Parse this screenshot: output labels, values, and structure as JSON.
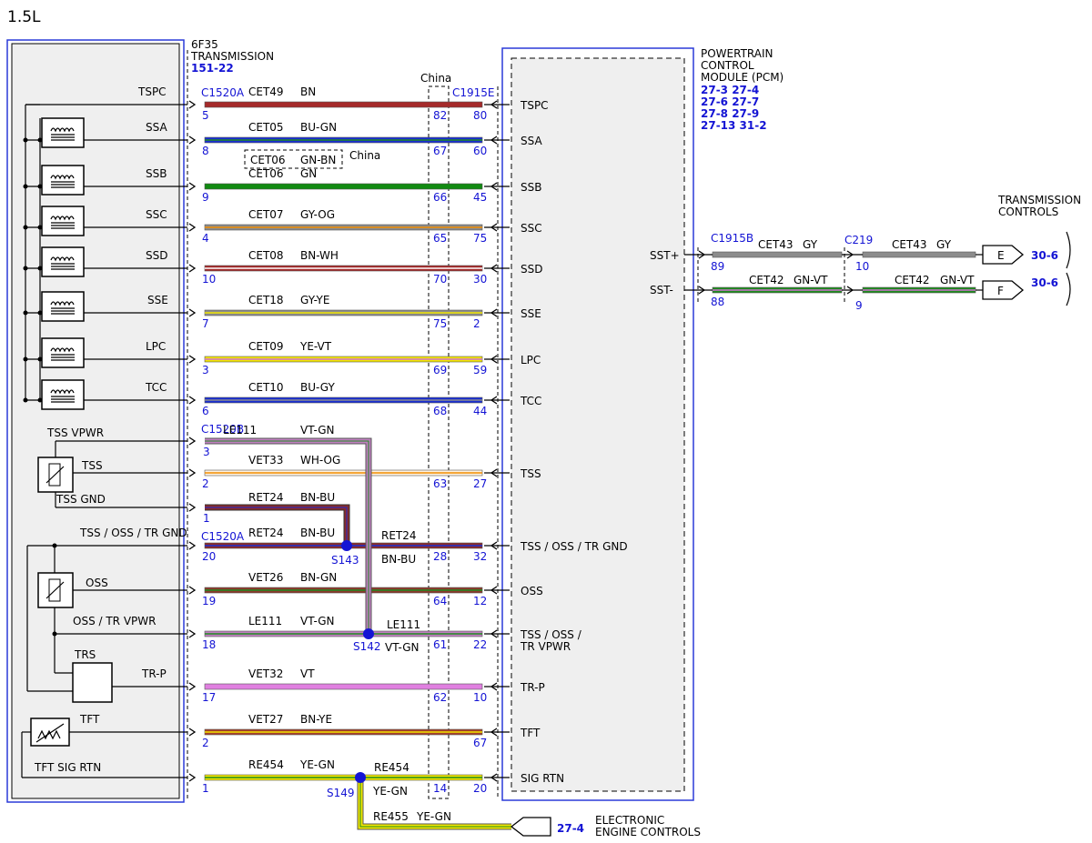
{
  "title": "1.5L",
  "trans": {
    "line1": "6F35",
    "line2": "TRANSMISSION",
    "ref": "151-22"
  },
  "pcm": {
    "line1": "POWERTRAIN",
    "line2": "CONTROL",
    "line3": "MODULE (PCM)",
    "refs": [
      "27-3  27-4",
      "27-6  27-7",
      "27-8  27-9",
      "27-13 31-2"
    ]
  },
  "china_label": "China",
  "china_alt": {
    "circuit": "CET06",
    "color": "GN-BN",
    "label": "China"
  },
  "conn": {
    "c1520a": "C1520A",
    "c1520b": "C1520B",
    "c1915e": "C1915E",
    "c1520a2": "C1520A",
    "c1915b": "C1915B",
    "c219": "C219"
  },
  "wires": [
    {
      "id": "tspc",
      "left": "TSPC",
      "circuit": "CET49",
      "color": "BN",
      "pin_l": "5",
      "pin_c": "82",
      "pin_r": "80",
      "right": "TSPC",
      "fill": "#a52a2a",
      "stripe": ""
    },
    {
      "id": "ssa",
      "left": "SSA",
      "circuit": "CET05",
      "color": "BU-GN",
      "pin_l": "8",
      "pin_c": "67",
      "pin_r": "60",
      "right": "SSA",
      "fill": "#1a2fd1",
      "stripe": "#1f8a1f"
    },
    {
      "id": "ssb",
      "left": "SSB",
      "circuit": "CET06",
      "color": "GN",
      "pin_l": "9",
      "pin_c": "66",
      "pin_r": "45",
      "right": "SSB",
      "fill": "#118a11",
      "stripe": ""
    },
    {
      "id": "ssc",
      "left": "SSC",
      "circuit": "CET07",
      "color": "GY-OG",
      "pin_l": "4",
      "pin_c": "65",
      "pin_r": "75",
      "right": "SSC",
      "fill": "#8c8c8c",
      "stripe": "#f08c00"
    },
    {
      "id": "ssd",
      "left": "SSD",
      "circuit": "CET08",
      "color": "BN-WH",
      "pin_l": "10",
      "pin_c": "70",
      "pin_r": "30",
      "right": "SSD",
      "fill": "#a52a2a",
      "stripe": "#ffffff"
    },
    {
      "id": "sse",
      "left": "SSE",
      "circuit": "CET18",
      "color": "GY-YE",
      "pin_l": "7",
      "pin_c": "75",
      "pin_r": "2",
      "right": "SSE",
      "fill": "#8c8c8c",
      "stripe": "#f2e600"
    },
    {
      "id": "lpc",
      "left": "LPC",
      "circuit": "CET09",
      "color": "YE-VT",
      "pin_l": "3",
      "pin_c": "69",
      "pin_r": "59",
      "right": "LPC",
      "fill": "#f2e600",
      "stripe": "#d070d0"
    },
    {
      "id": "tcc",
      "left": "TCC",
      "circuit": "CET10",
      "color": "BU-GY",
      "pin_l": "6",
      "pin_c": "68",
      "pin_r": "44",
      "right": "TCC",
      "fill": "#1a2fd1",
      "stripe": "#8c8c8c"
    },
    {
      "id": "tss",
      "left": "TSS",
      "circuit": "VET33",
      "color": "WH-OG",
      "pin_l": "2",
      "pin_c": "63",
      "pin_r": "27",
      "right": "TSS",
      "fill": "#fff2e0",
      "stripe": "#f08c00"
    },
    {
      "id": "tssgnd",
      "left": "TSS / OSS / TR GND",
      "circuit": "RET24",
      "color": "BN-BU",
      "pin_l": "20",
      "pin_c": "28",
      "pin_r": "32",
      "right": "TSS / OSS / TR GND",
      "fill": "#8a2a2a",
      "stripe": "#1a2fd1"
    },
    {
      "id": "oss",
      "left": "OSS",
      "circuit": "VET26",
      "color": "BN-GN",
      "pin_l": "19",
      "pin_c": "64",
      "pin_r": "12",
      "right": "OSS",
      "fill": "#8a3a2a",
      "stripe": "#1f8a1f"
    },
    {
      "id": "ossvpwr",
      "left": "OSS / TR VPWR",
      "circuit": "LE111",
      "color": "VT-GN",
      "pin_l": "18",
      "pin_c": "61",
      "pin_r": "22",
      "right": "TSS / OSS /",
      "right2": "TR VPWR",
      "fill": "#c080c0",
      "stripe": "#1f8a1f"
    },
    {
      "id": "trp",
      "left": "TR-P",
      "circuit": "VET32",
      "color": "VT",
      "pin_l": "17",
      "pin_c": "62",
      "pin_r": "10",
      "right": "TR-P",
      "fill": "#e080e0",
      "stripe": ""
    },
    {
      "id": "tft",
      "left": "TFT",
      "circuit": "VET27",
      "color": "BN-YE",
      "pin_l": "2",
      "pin_c": "",
      "pin_r": "67",
      "right": "TFT",
      "fill": "#a5402a",
      "stripe": "#f2e600"
    },
    {
      "id": "sigrtn",
      "left": "TFT SIG RTN",
      "circuit": "RE454",
      "color": "YE-GN",
      "pin_l": "1",
      "pin_c": "14",
      "pin_r": "20",
      "right": "SIG RTN",
      "fill": "#f2e600",
      "stripe": "#1f8a1f"
    }
  ],
  "tss_vpwr": {
    "label": "TSS VPWR",
    "circuit": "LE111",
    "color": "VT-GN",
    "pin": "3"
  },
  "tss_gnd": {
    "label": "TSS GND",
    "circuit": "RET24",
    "color": "BN-BU",
    "pin": "1"
  },
  "trs_label": "TRS",
  "splices": {
    "s143": "S143",
    "s142": "S142",
    "s149": "S149"
  },
  "splice_right": {
    "ret24": "RET24",
    "ret24_color": "BN-BU",
    "le111": "LE111",
    "le111_color": "VT-GN",
    "re454": "RE454",
    "re454_color": "YE-GN"
  },
  "eec": {
    "circuit": "RE455",
    "color": "YE-GN",
    "ref": "27-4",
    "line1": "ELECTRONIC",
    "line2": "ENGINE CONTROLS"
  },
  "sst": {
    "plus": {
      "label": "SST+",
      "pin_pcm": "89",
      "circuit": "CET43",
      "color": "GY",
      "pin_c219": "10",
      "circuit2": "CET43",
      "color2": "GY",
      "dest": "E",
      "ref": "30-6"
    },
    "minus": {
      "label": "SST-",
      "pin_pcm": "88",
      "circuit": "CET42",
      "color": "GN-VT",
      "pin_c219": "9",
      "circuit2": "CET42",
      "color2": "GN-VT",
      "dest": "F",
      "ref": "30-6"
    }
  },
  "tc": {
    "line1": "TRANSMISSION",
    "line2": "CONTROLS"
  }
}
